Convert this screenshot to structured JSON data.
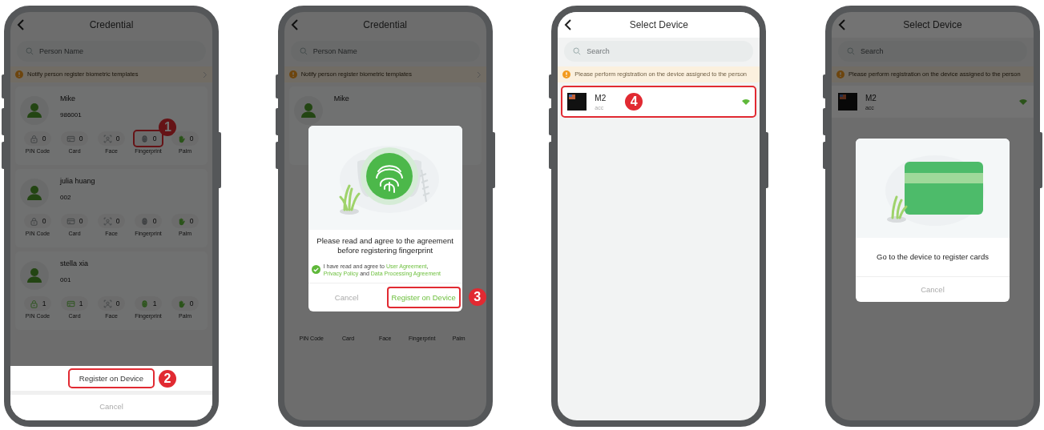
{
  "phones": [
    {
      "kind": "credential_list",
      "dimmed": true,
      "title": "Credential",
      "search": {
        "placeholder": "Person Name"
      },
      "notice": "Notify person register biometric templates",
      "persons": [
        {
          "name": "Mike",
          "number": "986001",
          "credentials": [
            {
              "kind": "pin",
              "count": "0",
              "label": "PIN Code",
              "active": false
            },
            {
              "kind": "card",
              "count": "0",
              "label": "Card",
              "active": false
            },
            {
              "kind": "face",
              "count": "0",
              "label": "Face",
              "active": false
            },
            {
              "kind": "fingerprint",
              "count": "0",
              "label": "Fingerprint",
              "active": false,
              "step": "1"
            },
            {
              "kind": "palm",
              "count": "0",
              "label": "Palm",
              "active": true
            }
          ]
        },
        {
          "name": "julia  huang",
          "number": "002",
          "credentials": [
            {
              "kind": "pin",
              "count": "0",
              "label": "PIN Code",
              "active": false
            },
            {
              "kind": "card",
              "count": "0",
              "label": "Card",
              "active": false
            },
            {
              "kind": "face",
              "count": "0",
              "label": "Face",
              "active": false
            },
            {
              "kind": "fingerprint",
              "count": "0",
              "label": "Fingerprint",
              "active": false
            },
            {
              "kind": "palm",
              "count": "0",
              "label": "Palm",
              "active": true
            }
          ]
        },
        {
          "name": "stella xia",
          "number": "001",
          "credentials": [
            {
              "kind": "pin",
              "count": "1",
              "label": "PIN Code",
              "active": true
            },
            {
              "kind": "card",
              "count": "1",
              "label": "Card",
              "active": true
            },
            {
              "kind": "face",
              "count": "0",
              "label": "Face",
              "active": false
            },
            {
              "kind": "fingerprint",
              "count": "1",
              "label": "Fingerprint",
              "active": true
            },
            {
              "kind": "palm",
              "count": "0",
              "label": "Palm",
              "active": true
            }
          ]
        }
      ],
      "sheet": {
        "actions": [
          {
            "kind": "primary",
            "label": "Register on Device",
            "step": "2"
          },
          {
            "kind": "cancel",
            "label": "Cancel"
          }
        ]
      }
    },
    {
      "kind": "credential_list",
      "dimmed": true,
      "title": "Credential",
      "search": {
        "placeholder": "Person Name"
      },
      "notice": "Notify person register biometric templates",
      "persons": [
        {
          "name": "Mike"
        }
      ],
      "credential_labels": [
        "PIN Code",
        "Card",
        "Face",
        "Fingerprint",
        "Palm"
      ],
      "dialog": {
        "kind": "fingerprint",
        "message": "Please read and agree to the agreement before registering fingerprint",
        "agreement": {
          "checked": true,
          "parts": [
            {
              "kind": "text",
              "text": "I have read and agree to "
            },
            {
              "kind": "link",
              "text": "User Agreement"
            },
            {
              "kind": "text",
              "text": ", "
            },
            {
              "kind": "link",
              "text": "Privacy Policy"
            },
            {
              "kind": "text",
              "text": " and "
            },
            {
              "kind": "link",
              "text": "Data Processing Agreement"
            }
          ]
        },
        "buttons": [
          {
            "kind": "cancel",
            "label": "Cancel"
          },
          {
            "kind": "confirm",
            "label": "Register on Device",
            "step": "3"
          }
        ]
      }
    },
    {
      "kind": "device_select",
      "dimmed": false,
      "title": "Select Device",
      "search": {
        "placeholder": "Search"
      },
      "notice": "Please perform registration on the device assigned to the person",
      "devices": [
        {
          "name": "M2",
          "group": "acc",
          "online": true,
          "step": "4"
        }
      ]
    },
    {
      "kind": "device_select",
      "dimmed": true,
      "title": "Select Device",
      "search": {
        "placeholder": "Search"
      },
      "notice": "Please perform registration on the device assigned to the person",
      "devices": [
        {
          "name": "M2",
          "group": "acc",
          "online": true
        }
      ],
      "dialog": {
        "kind": "card",
        "message": "Go to the device to register cards",
        "buttons": [
          {
            "kind": "cancel",
            "label": "Cancel"
          }
        ]
      }
    }
  ]
}
